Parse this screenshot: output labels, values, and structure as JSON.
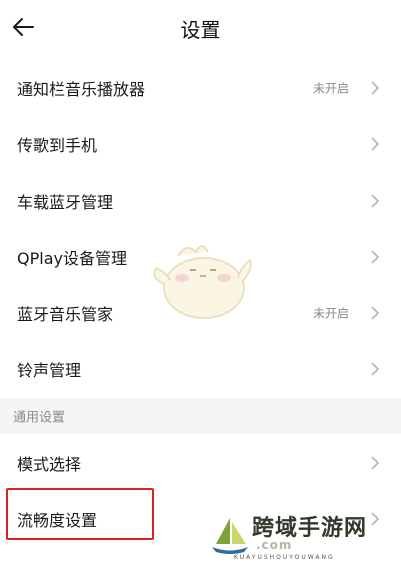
{
  "header": {
    "title": "设置",
    "back_icon": "back-arrow-icon"
  },
  "settings": {
    "items": [
      {
        "label": "通知栏音乐播放器",
        "value": "未开启"
      },
      {
        "label": "传歌到手机",
        "value": ""
      },
      {
        "label": "车载蓝牙管理",
        "value": ""
      },
      {
        "label": "QPlay设备管理",
        "value": ""
      },
      {
        "label": "蓝牙音乐管家",
        "value": "未开启"
      },
      {
        "label": "铃声管理",
        "value": ""
      }
    ]
  },
  "general": {
    "section_label": "通用设置",
    "items": [
      {
        "label": "模式选择",
        "value": ""
      },
      {
        "label": "流畅度设置",
        "value": ""
      }
    ]
  },
  "watermark": {
    "brand": "跨域手游网",
    "domain": ".com",
    "pinyin": "KUAYUSHOUYOUWANG"
  },
  "colors": {
    "highlight": "#e02020",
    "section_bg": "#f5f5f5",
    "muted_text": "#8a8a8a",
    "chevron": "#b5b5b5"
  }
}
